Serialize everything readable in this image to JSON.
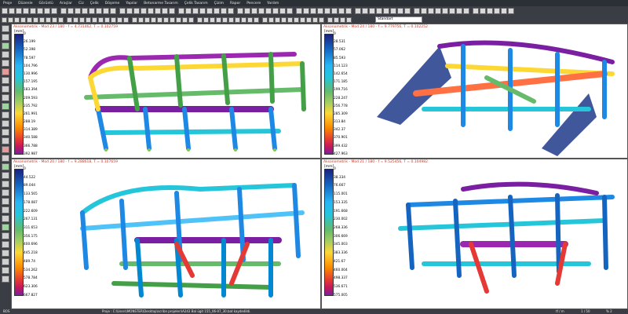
{
  "menu": [
    "Proje",
    "Düzenle",
    "Görüntü",
    "Araçlar",
    "Ciz",
    "Çelik",
    "Döşeme",
    "Yapılar",
    "Betonarme Tasarım",
    "Çelik Tasarım",
    "Çizim",
    "Rapor",
    "Pencere",
    "Yardım"
  ],
  "view_dropdown": "Standart",
  "viewports": [
    {
      "title": "Aksonometrik - Mod 23 / 180 - f = 4.731462, T = 0.102759",
      "unit": "[mm]",
      "legend": [
        "0",
        "26.199",
        "52.398",
        "78.597",
        "104.796",
        "130.996",
        "157.195",
        "183.394",
        "209.593",
        "235.792",
        "261.991",
        "288.19",
        "314.389",
        "340.588",
        "366.788",
        "392.987"
      ]
    },
    {
      "title": "Aksonometrik - Mod 24 / 180 - f = 9.779756, T = 0.102252",
      "unit": "[mm]",
      "legend": [
        "0",
        "28.531",
        "57.062",
        "85.593",
        "114.123",
        "142.654",
        "171.185",
        "199.716",
        "228.247",
        "256.778",
        "285.309",
        "313.84",
        "342.37",
        "370.901",
        "399.432",
        "427.963"
      ]
    },
    {
      "title": "Aksonometrik - Mod 20 / 180 - f = 9.288618, T = 0.107659",
      "unit": "[mm]",
      "legend": [
        "0",
        "44.522",
        "89.044",
        "133.565",
        "178.087",
        "222.609",
        "267.131",
        "311.653",
        "356.175",
        "400.696",
        "445.218",
        "489.74",
        "534.262",
        "578.784",
        "623.306",
        "667.827"
      ]
    },
    {
      "title": "Aksonometrik - Mod 21 / 180 - f = 9.525456, T = 0.104982",
      "unit": "[mm]",
      "legend": [
        "0",
        "38.334",
        "76.667",
        "115.001",
        "153.335",
        "191.668",
        "230.002",
        "268.336",
        "306.669",
        "345.003",
        "383.336",
        "421.67",
        "460.004",
        "498.337",
        "536.671",
        "575.005"
      ]
    }
  ],
  "status": {
    "left": "BOS",
    "path": "Proje : C:\\Users\\MONSTER\\Desktop\\scribn projeleri\\A243 Bal ügit 155_06-07_30.bat kaydedildi.",
    "units": "tf / m",
    "scale": "1 / 50",
    "zoom": "% 2"
  }
}
